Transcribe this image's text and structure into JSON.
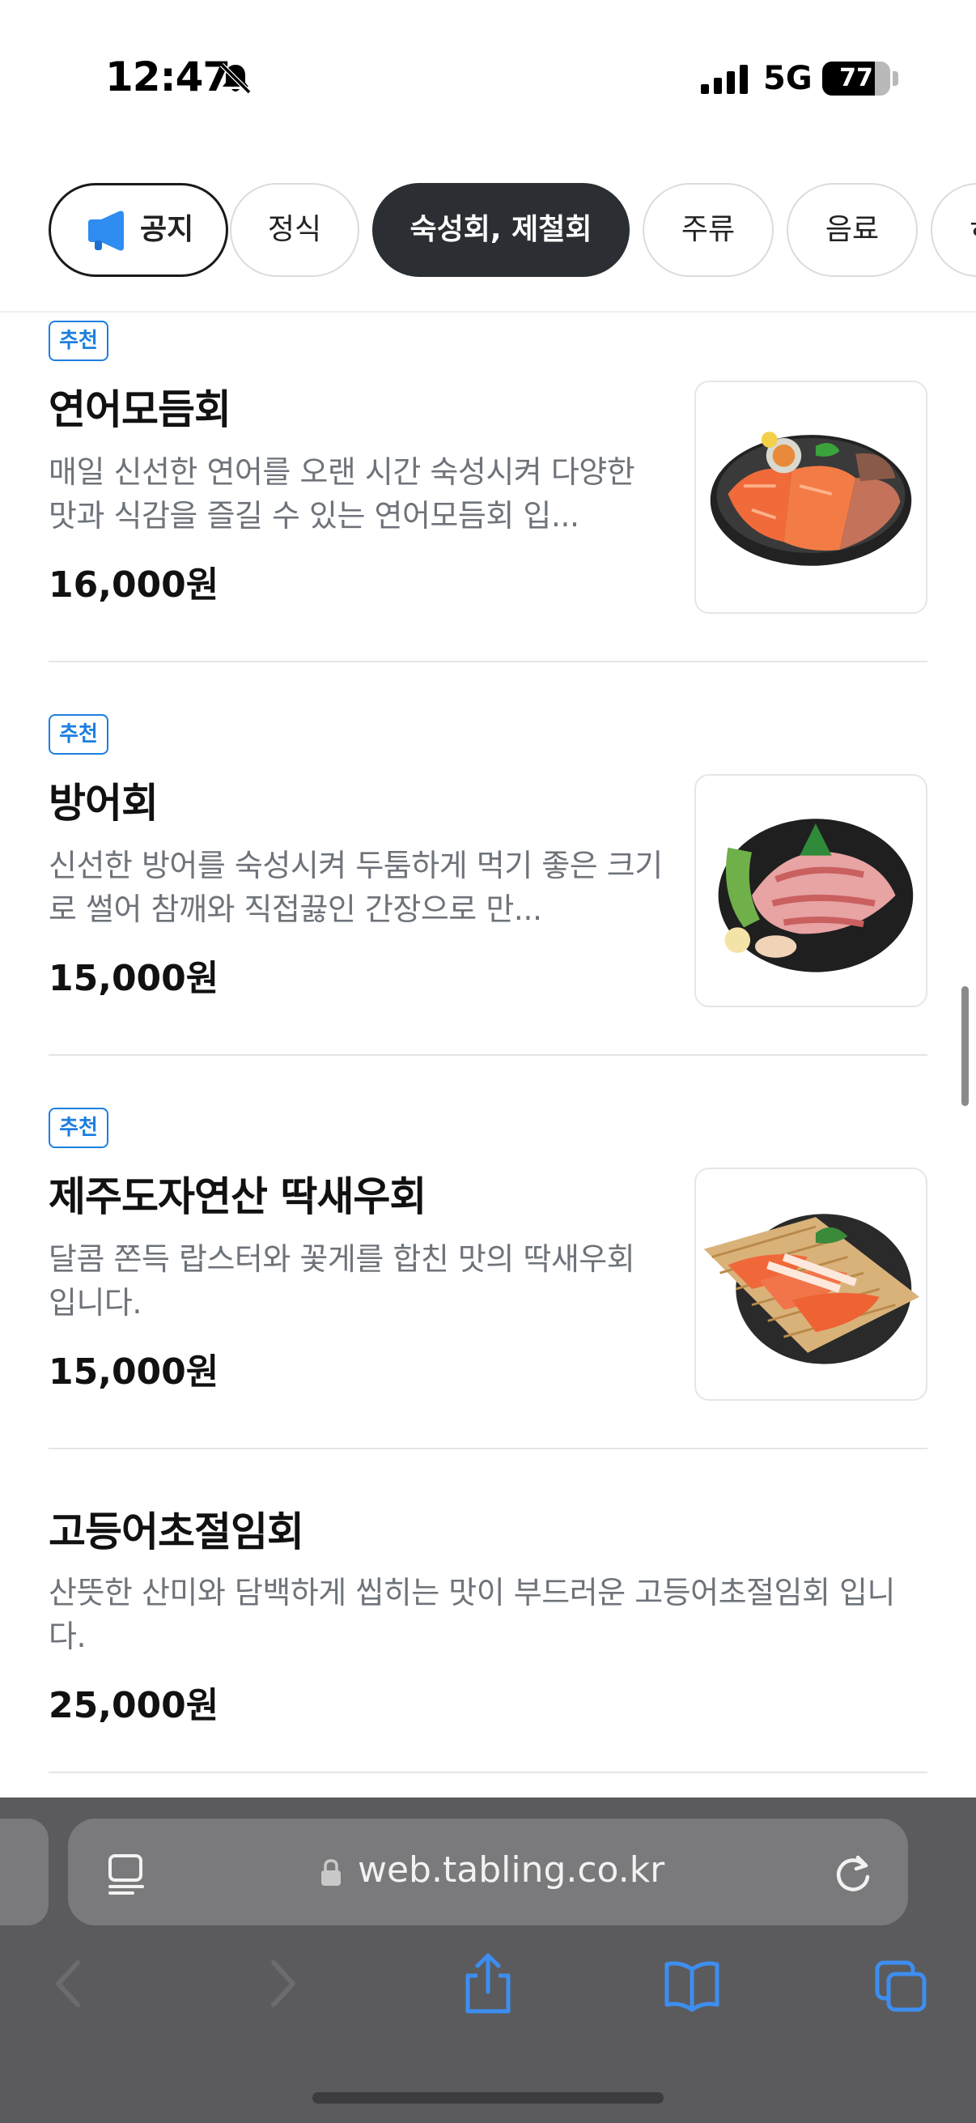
{
  "status_bar": {
    "time": "12:47",
    "network": "5G",
    "battery": "77",
    "battery_level": 0.77
  },
  "tabs": [
    {
      "label": "공지",
      "icon": "megaphone-icon"
    },
    {
      "label": "정식"
    },
    {
      "label": "숙성회, 제철회",
      "active": true
    },
    {
      "label": "주류"
    },
    {
      "label": "음료"
    },
    {
      "label": "ㅎ"
    }
  ],
  "menu": {
    "items": [
      {
        "badge": "추천",
        "name": "연어모듬회",
        "description": "매일 신선한 연어를 오랜 시간 숙성시켜 다양한 맛과 식감을 즐길 수 있는 연어모듬회 입...",
        "price": "16,000원"
      },
      {
        "badge": "추천",
        "name": "방어회",
        "description": "신선한 방어를 숙성시켜 두툼하게 먹기 좋은 크기로 썰어 참깨와 직접끓인 간장으로 만...",
        "price": "15,000원"
      },
      {
        "badge": "추천",
        "name": "제주도자연산 딱새우회",
        "description": "달콤 쫀득 랍스터와 꽃게를 합친 맛의 딱새우회 입니다.",
        "price": "15,000원"
      },
      {
        "name": "고등어초절임회",
        "description": "산뜻한 산미와 담백하게 씹히는 맛이 부드러운 고등어초절임회 입니다.",
        "price": "25,000원"
      }
    ]
  },
  "browser": {
    "url": "web.tabling.co.kr"
  },
  "colors": {
    "accent_blue": "#1d7fe0",
    "active_tab": "#2b2e33",
    "toolbar_icon": "#3d8ef0"
  }
}
